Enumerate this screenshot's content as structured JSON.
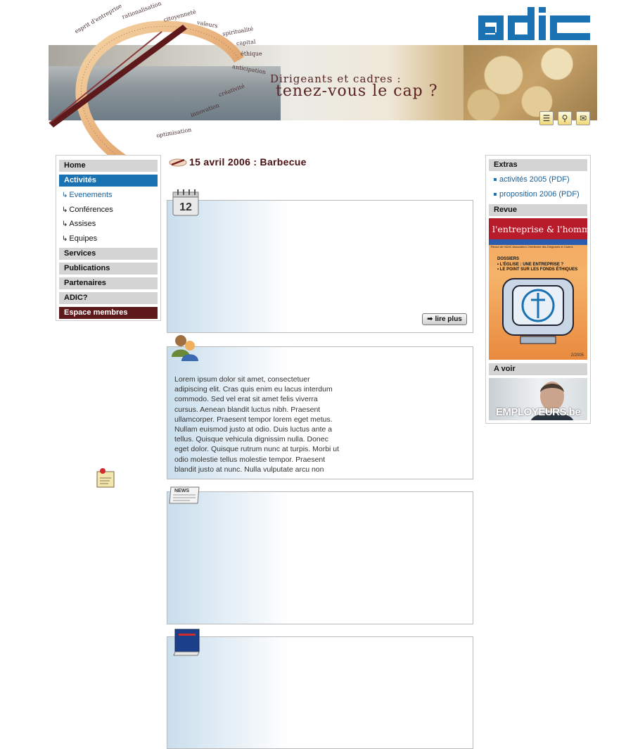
{
  "header": {
    "logo_text": "adic",
    "tagline_line1": "Dirigeants et cadres :",
    "tagline_line2": "tenez-vous le cap ?",
    "arc_words": [
      "esprit d'entreprise",
      "rationalisation",
      "citoyenneté",
      "valeurs",
      "spiritualité",
      "capital",
      "éthique",
      "anticipation",
      "créativité",
      "innovation",
      "optimisation"
    ],
    "tools": [
      "sitemap-icon",
      "search-icon",
      "mail-icon"
    ]
  },
  "nav": {
    "items": [
      {
        "label": "Home"
      },
      {
        "label": "Activités"
      },
      {
        "label": "Services"
      },
      {
        "label": "Publications"
      },
      {
        "label": "Partenaires"
      },
      {
        "label": "ADIC?"
      },
      {
        "label": "Espace membres"
      }
    ],
    "subitems": [
      {
        "label": "Evenements"
      },
      {
        "label": "Conférences"
      },
      {
        "label": "Assises"
      },
      {
        "label": "Equipes"
      }
    ]
  },
  "main": {
    "title": "15 avril 2006 : Barbecue",
    "calendar_day": "12",
    "read_more": "lire plus",
    "news_label": "NEWS",
    "body_text": "Lorem ipsum dolor sit amet, consectetuer adipiscing elit. Cras quis enim eu lacus interdum commodo. Sed vel erat sit amet felis viverra cursus. Aenean blandit luctus nibh. Praesent ullamcorper. Praesent tempor lorem eget metus. Nullam euismod justo at odio. Duis luctus ante a tellus. Quisque vehicula dignissim nulla. Donec eget dolor. Quisque rutrum nunc at turpis. Morbi ut odio molestie tellus molestie tempor. Praesent blandit justo at nunc. Nulla vulputate arcu non"
  },
  "sidebar": {
    "extras_title": "Extras",
    "links": [
      {
        "label": "activités 2005 (PDF)"
      },
      {
        "label": "proposition 2006 (PDF)"
      }
    ],
    "revue_title": "Revue",
    "magazine": {
      "title": "l'entreprise & l'homme",
      "subtitle": "Revue de l'ADIC Association Chrétienne des Dirigeants et Cadres",
      "dossiers": "DOSSIERS",
      "line1": "• L'ÉGLISE : UNE ENTREPRISE ?",
      "line2": "• LE POINT SUR LES FONDS ÉTHIQUES",
      "issue": "2/2005"
    },
    "avoir_title": "A voir",
    "ad_text": "EMPLOYEURS.be"
  }
}
